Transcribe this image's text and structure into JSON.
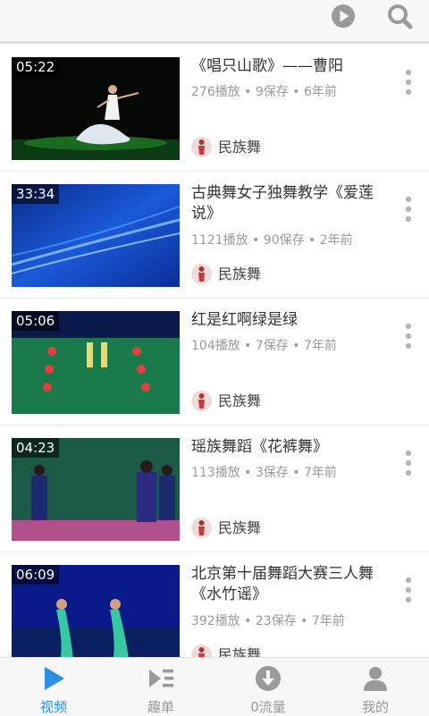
{
  "colors": {
    "accent": "#2d8fe0",
    "icon_gray": "#9a9a9a",
    "text": "#333333",
    "meta": "#9a9a9a"
  },
  "topbar": {
    "icons": [
      "play-circle-icon",
      "search-icon"
    ]
  },
  "videos": [
    {
      "duration": "05:22",
      "title": "《唱只山歌》——曹阳",
      "meta": "276播放 • 9保存 • 6年前",
      "channel": "民族舞"
    },
    {
      "duration": "33:34",
      "title": "古典舞女子独舞教学《爱莲说》",
      "meta": "1121播放 • 90保存 • 2年前",
      "channel": "民族舞"
    },
    {
      "duration": "05:06",
      "title": "红是红啊绿是绿",
      "meta": "104播放 • 7保存 • 7年前",
      "channel": "民族舞"
    },
    {
      "duration": "04:23",
      "title": "瑶族舞蹈《花裤舞》",
      "meta": "113播放 • 3保存 • 7年前",
      "channel": "民族舞"
    },
    {
      "duration": "06:09",
      "title": "北京第十届舞蹈大赛三人舞《水竹谣》",
      "meta": "392播放 • 23保存 • 7年前",
      "channel": "民族舞"
    }
  ],
  "tabs": [
    {
      "label": "视频",
      "icon": "play-triangle-icon",
      "active": true
    },
    {
      "label": "趣单",
      "icon": "playlist-icon",
      "active": false
    },
    {
      "label": "0流量",
      "icon": "download-icon",
      "active": false
    },
    {
      "label": "我的",
      "icon": "person-icon",
      "active": false
    }
  ]
}
